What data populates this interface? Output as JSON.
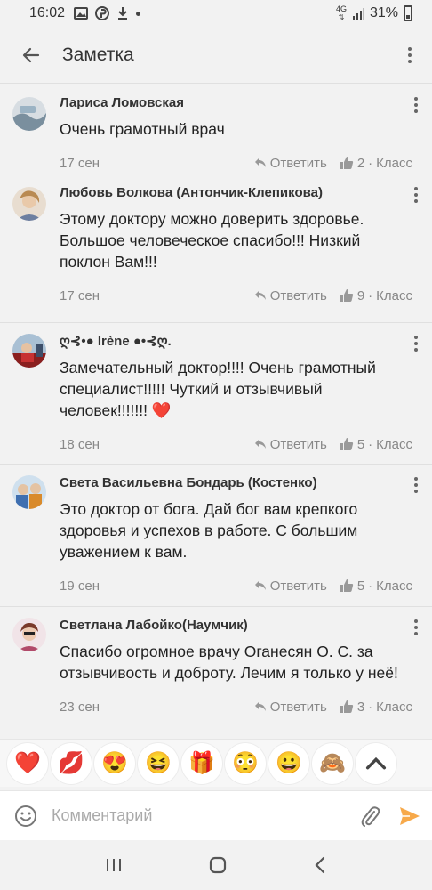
{
  "status_bar": {
    "time": "16:02",
    "network": "4G",
    "battery": "31%",
    "icons": [
      "image-icon",
      "pinterest-icon",
      "download-icon",
      "dot-icon"
    ]
  },
  "app_bar": {
    "title": "Заметка",
    "back_icon": "arrow-left-icon",
    "menu_icon": "more-vert-icon"
  },
  "comments": [
    {
      "author": "Лариса Ломовская",
      "text": "Очень грамотный врач",
      "date": "17 сен",
      "reply_label": "Ответить",
      "likes": "2",
      "like_label": "Класс",
      "avatar_color": "#8aa4b8"
    },
    {
      "author": "Любовь Волкова (Антончик-Клепикова)",
      "text": "Этому доктору можно доверить здоровье. Большое человеческое спасибо!!! Низкий поклон Вам!!!",
      "date": "17 сен",
      "reply_label": "Ответить",
      "likes": "9",
      "like_label": "Класс",
      "avatar_color": "#c9a87a"
    },
    {
      "author": "ღ⊰•● Irène ●•⊰ღ.",
      "text": "Замечательный доктор!!!! Очень грамотный специалист!!!!! Чуткий и отзывчивый человек!!!!!!!",
      "text_emoji": "❤️",
      "date": "18 сен",
      "reply_label": "Ответить",
      "likes": "5",
      "like_label": "Класс",
      "avatar_color": "#b33a3a"
    },
    {
      "author": "Света Васильевна Бондарь (Костенко)",
      "text": "Это доктор от бога. Дай бог вам крепкого здоровья и успехов в работе. С большим уважением к вам.",
      "date": "19 сен",
      "reply_label": "Ответить",
      "likes": "5",
      "like_label": "Класс",
      "avatar_color": "#4a7fb5"
    },
    {
      "author": "Светлана Лабойко(Наумчик)",
      "text": "Спасибо огромное врачу Оганесян О. С. за отзывчивость и  доброту. Лечим я только у неё!",
      "date": "23 сен",
      "reply_label": "Ответить",
      "likes": "3",
      "like_label": "Класс",
      "avatar_color": "#c97a8a"
    }
  ],
  "reactions": [
    {
      "name": "heart-icon",
      "glyph": "❤️"
    },
    {
      "name": "kiss-lips-icon",
      "glyph": "💋"
    },
    {
      "name": "heart-eyes-icon",
      "glyph": "😍"
    },
    {
      "name": "laughing-icon",
      "glyph": "😆"
    },
    {
      "name": "gift-icon",
      "glyph": "🎁"
    },
    {
      "name": "shocked-icon",
      "glyph": "😳"
    },
    {
      "name": "grinning-icon",
      "glyph": "😀"
    },
    {
      "name": "see-no-evil-monkey-icon",
      "glyph": "🙈"
    }
  ],
  "composer": {
    "placeholder": "Комментарий",
    "value": ""
  },
  "colors": {
    "accent": "#f7931e",
    "meta_text": "#888888",
    "background": "#f2f2f2"
  }
}
